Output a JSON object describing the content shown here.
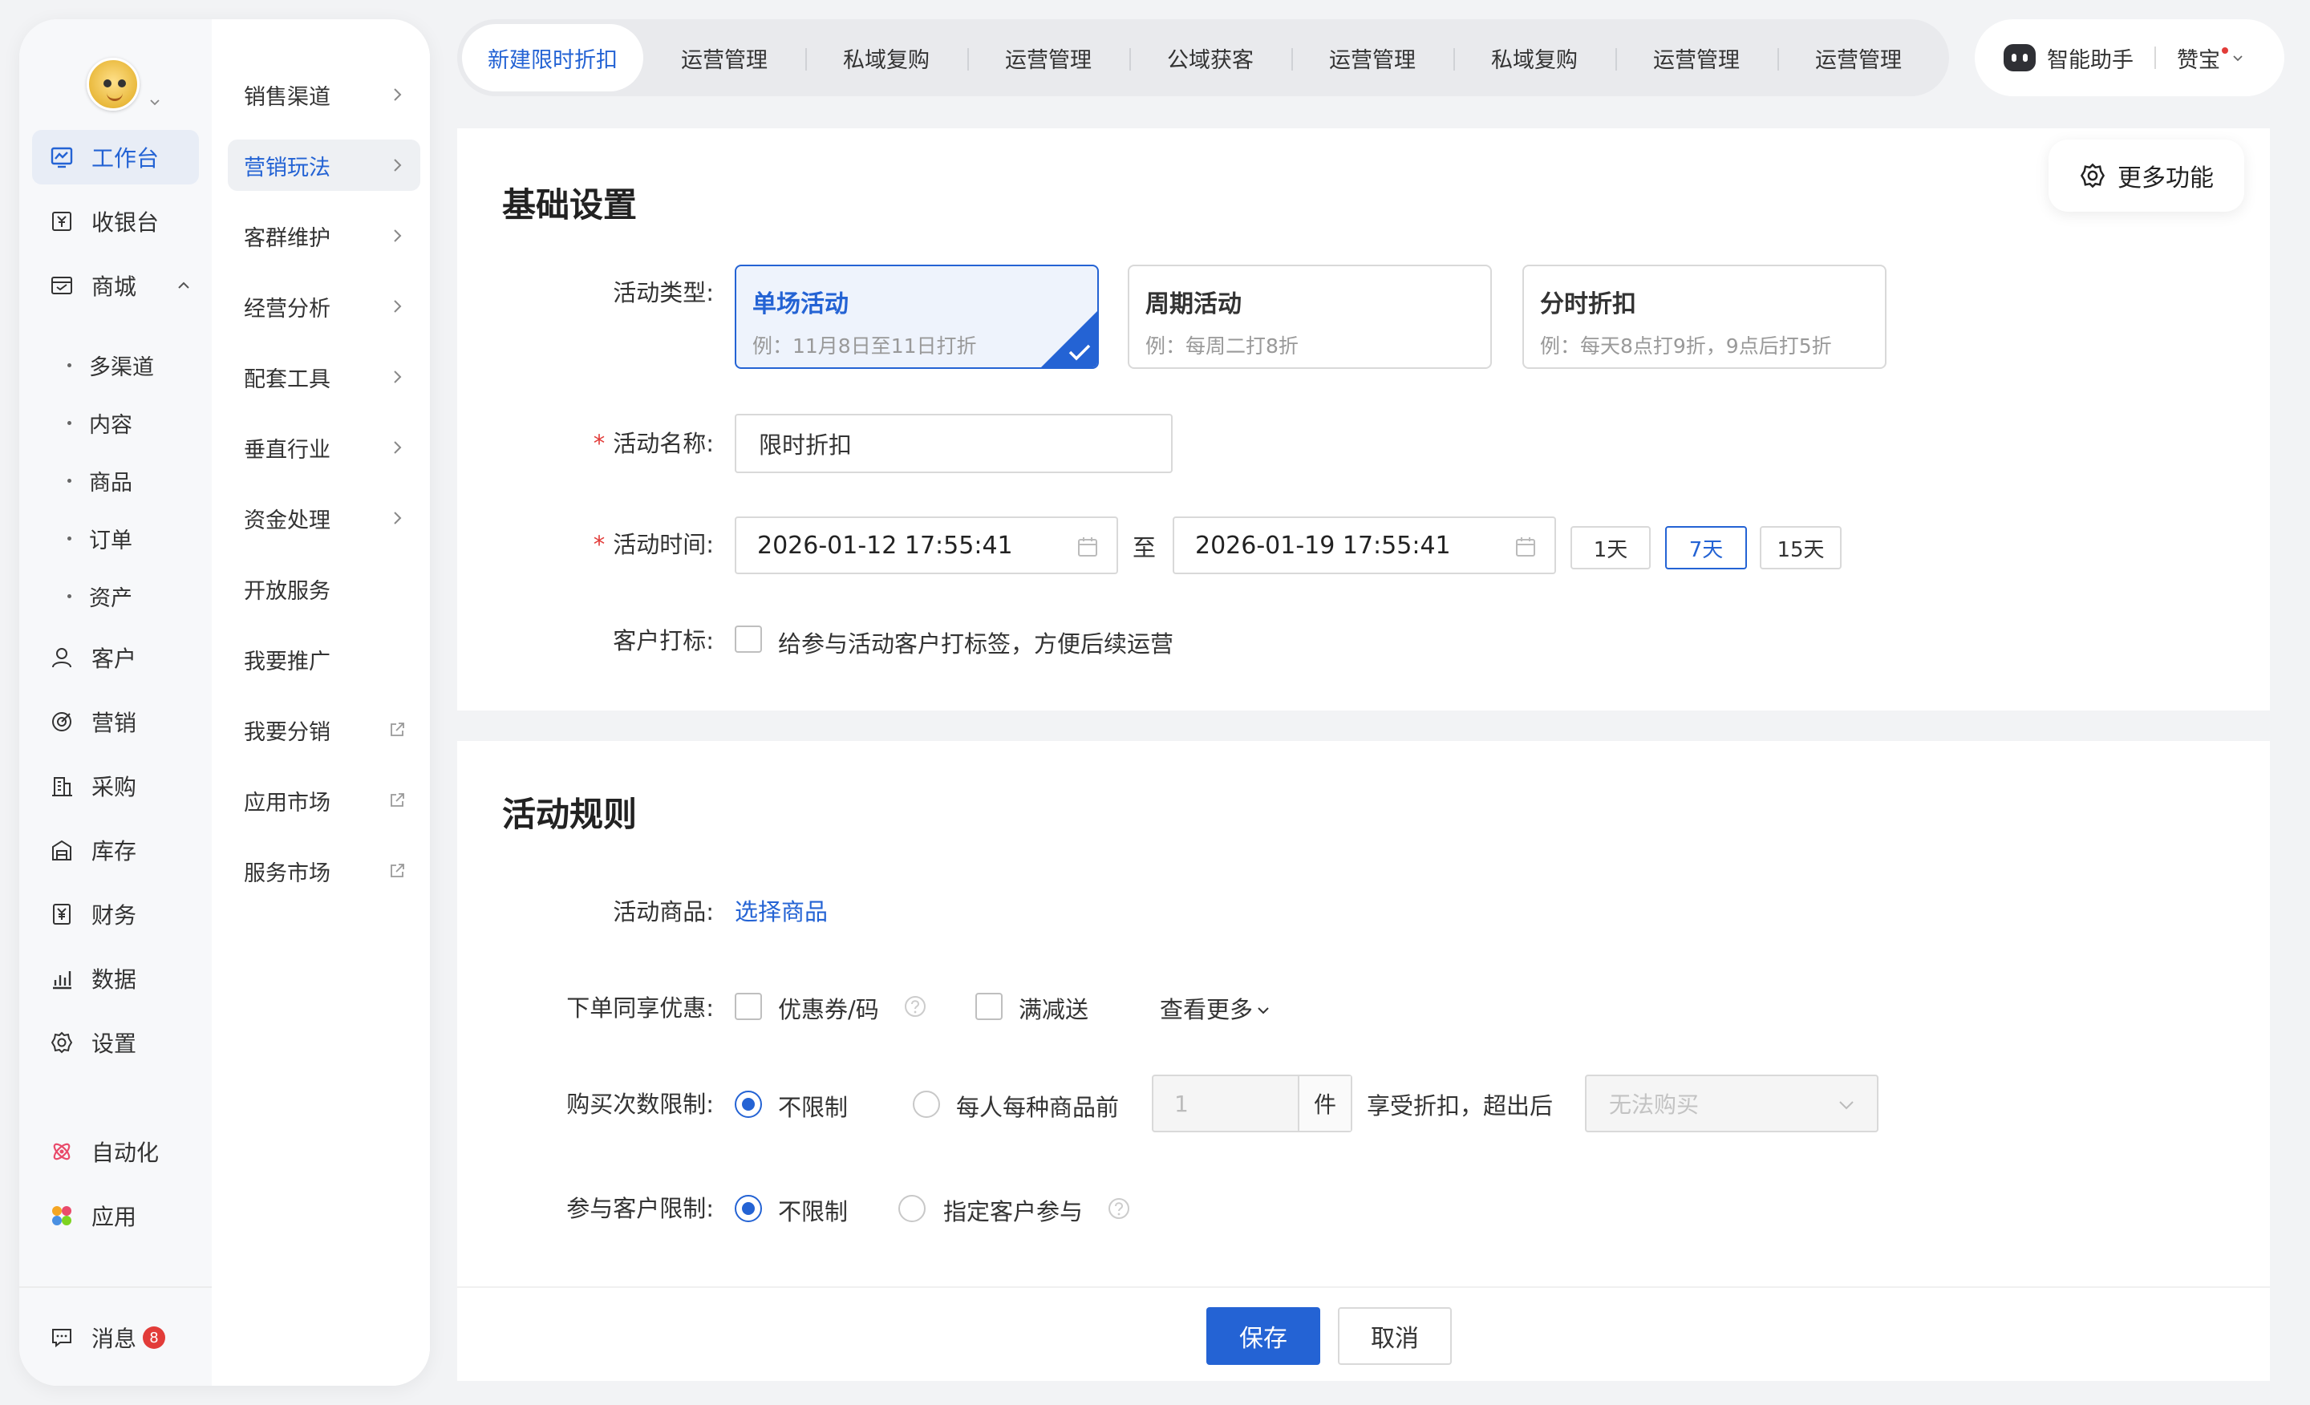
{
  "primary_nav": {
    "items": [
      {
        "label": "工作台",
        "icon": "dashboard-icon",
        "active": true
      },
      {
        "label": "收银台",
        "icon": "cashier-icon"
      },
      {
        "label": "商城",
        "icon": "store-icon",
        "expanded": true
      },
      {
        "label": "客户",
        "icon": "user-icon"
      },
      {
        "label": "营销",
        "icon": "target-icon"
      },
      {
        "label": "采购",
        "icon": "building-icon"
      },
      {
        "label": "库存",
        "icon": "warehouse-icon"
      },
      {
        "label": "财务",
        "icon": "yen-icon"
      },
      {
        "label": "数据",
        "icon": "bar-chart-icon"
      },
      {
        "label": "设置",
        "icon": "gear-icon"
      },
      {
        "label": "自动化",
        "icon": "automation-icon"
      },
      {
        "label": "应用",
        "icon": "apps-icon"
      }
    ],
    "store_sub_items": [
      "多渠道",
      "内容",
      "商品",
      "订单",
      "资产"
    ],
    "message": {
      "label": "消息",
      "badge": "8"
    }
  },
  "secondary_nav": {
    "items": [
      {
        "label": "销售渠道",
        "trail": "chevron-right-icon"
      },
      {
        "label": "营销玩法",
        "trail": "chevron-right-icon",
        "active": true
      },
      {
        "label": "客群维护",
        "trail": "chevron-right-icon"
      },
      {
        "label": "经营分析",
        "trail": "chevron-right-icon"
      },
      {
        "label": "配套工具",
        "trail": "chevron-right-icon"
      },
      {
        "label": "垂直行业",
        "trail": "chevron-right-icon"
      },
      {
        "label": "资金处理",
        "trail": "chevron-right-icon"
      },
      {
        "label": "开放服务",
        "trail": ""
      },
      {
        "label": "我要推广",
        "trail": ""
      },
      {
        "label": "我要分销",
        "trail": "external-link-icon"
      },
      {
        "label": "应用市场",
        "trail": "external-link-icon"
      },
      {
        "label": "服务市场",
        "trail": "external-link-icon"
      }
    ]
  },
  "tabs": [
    "新建限时折扣",
    "运营管理",
    "私域复购",
    "运营管理",
    "公域获客",
    "运营管理",
    "私域复购",
    "运营管理",
    "运营管理"
  ],
  "assistant": {
    "label": "智能助手",
    "user": "赞宝"
  },
  "more_features": "更多功能",
  "basic": {
    "title": "基础设置",
    "type_label": "活动类型:",
    "types": [
      {
        "title": "单场活动",
        "desc": "例：11月8日至11日打折"
      },
      {
        "title": "周期活动",
        "desc": "例：每周二打8折"
      },
      {
        "title": "分时折扣",
        "desc": "例：每天8点打9折，9点后打5折"
      }
    ],
    "name_label": "活动名称:",
    "name_value": "限时折扣",
    "time_label": "活动时间:",
    "start": "2026-01-12 17:55:41",
    "to": "至",
    "end": "2026-01-19 17:55:41",
    "quick": [
      "1天",
      "7天",
      "15天"
    ],
    "tag_label": "客户打标:",
    "tag_text": "给参与活动客户打标签，方便后续运营"
  },
  "rules": {
    "title": "活动规则",
    "goods_label": "活动商品:",
    "goods_link": "选择商品",
    "stack_label": "下单同享优惠:",
    "coupon": "优惠券/码",
    "full_reduce": "满减送",
    "see_more": "查看更多",
    "limit_label": "购买次数限制:",
    "unlimited": "不限制",
    "per_person": "每人每种商品前",
    "qty_placeholder": "1",
    "unit": "件",
    "after_text": "享受折扣，超出后",
    "after_select": "无法购买",
    "cust_label": "参与客户限制:",
    "cust_unlimited": "不限制",
    "cust_specified": "指定客户参与"
  },
  "footer": {
    "save": "保存",
    "cancel": "取消"
  },
  "colors": {
    "accent": "#2463d4",
    "required": "#e23c39"
  }
}
